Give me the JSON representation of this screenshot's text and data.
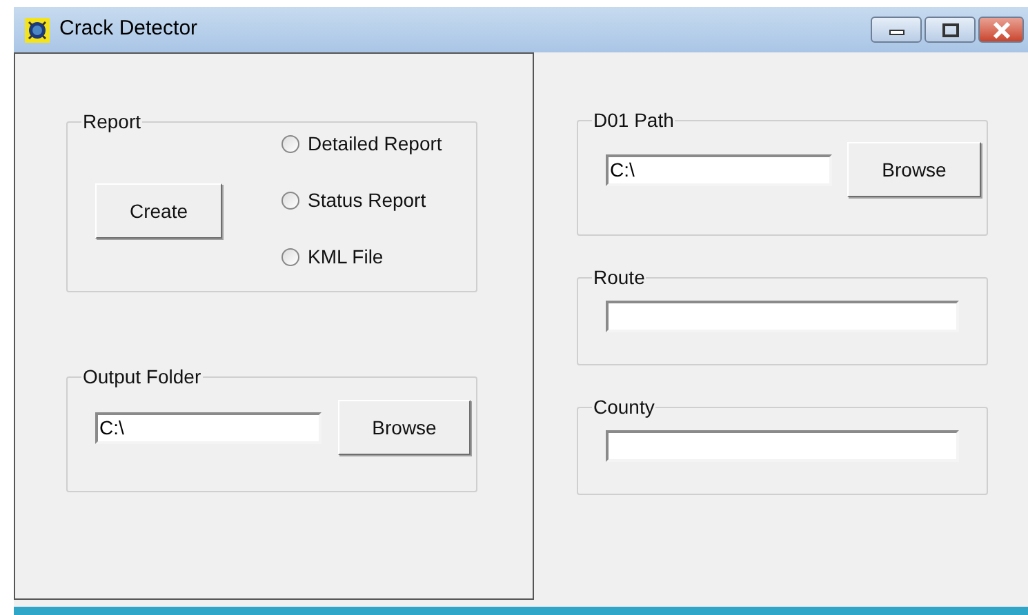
{
  "window": {
    "title": "Crack Detector"
  },
  "report": {
    "label": "Report",
    "button": "Create",
    "options": [
      {
        "label": "Detailed Report",
        "selected": false
      },
      {
        "label": "Status Report",
        "selected": false
      },
      {
        "label": "KML File",
        "selected": false
      }
    ]
  },
  "output_folder": {
    "label": "Output Folder",
    "value": "C:\\",
    "button": "Browse"
  },
  "d01_path": {
    "label": "D01 Path",
    "value": "C:\\",
    "button": "Browse"
  },
  "route": {
    "label": "Route"
  },
  "county": {
    "label": "County"
  }
}
